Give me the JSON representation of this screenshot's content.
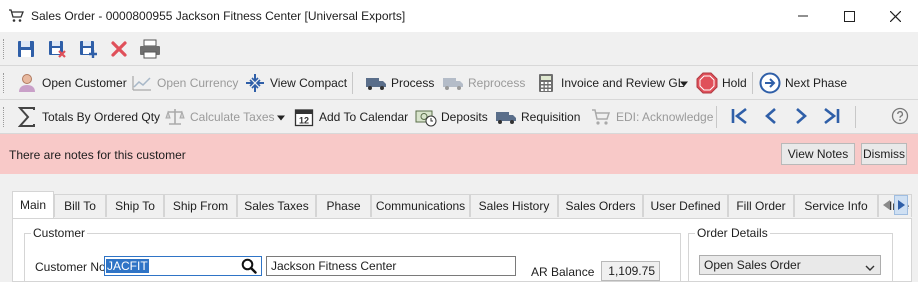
{
  "window": {
    "title": "Sales Order - 0000800955 Jackson Fitness Center [Universal Exports]"
  },
  "toolbar1": {
    "icons": [
      "save-icon",
      "save-close-icon",
      "save-new-icon",
      "delete-icon",
      "print-icon"
    ]
  },
  "toolbar2": {
    "open_customer": "Open Customer",
    "open_currency": "Open Currency",
    "view_compact": "View Compact",
    "process": "Process",
    "reprocess": "Reprocess",
    "invoice_review_gl": "Invoice and Review GL",
    "hold": "Hold",
    "next_phase": "Next Phase"
  },
  "toolbar3": {
    "totals_by_ordered_qty": "Totals By Ordered Qty",
    "calculate_taxes": "Calculate Taxes",
    "add_to_calendar": "Add To Calendar",
    "deposits": "Deposits",
    "requisition": "Requisition",
    "edi_acknowledge": "EDI: Acknowledge",
    "calendar_day": "12"
  },
  "notes_bar": {
    "message": "There are notes for this customer",
    "view_notes": "View Notes",
    "dismiss": "Dismiss",
    "color": "#f8c9c8"
  },
  "tabs": [
    {
      "label": "Main",
      "active": true
    },
    {
      "label": "Bill To"
    },
    {
      "label": "Ship To"
    },
    {
      "label": "Ship From"
    },
    {
      "label": "Sales Taxes"
    },
    {
      "label": "Phase"
    },
    {
      "label": "Communications"
    },
    {
      "label": "Sales History"
    },
    {
      "label": "Sales Orders"
    },
    {
      "label": "User Defined"
    },
    {
      "label": "Fill Order"
    },
    {
      "label": "Service Info"
    },
    {
      "label": "Inte"
    }
  ],
  "customer": {
    "group_label": "Customer",
    "customer_no_label": "Customer No",
    "customer_no_value": "JACFIT",
    "customer_name": "Jackson Fitness Center",
    "ar_balance_label": "AR Balance",
    "ar_balance_value": "1,109.75"
  },
  "order_details": {
    "group_label": "Order Details",
    "order_type": "Open Sales Order"
  },
  "colors": {
    "accent": "#2f74c6",
    "delete": "#e0505a",
    "hold": "#e0505a"
  }
}
